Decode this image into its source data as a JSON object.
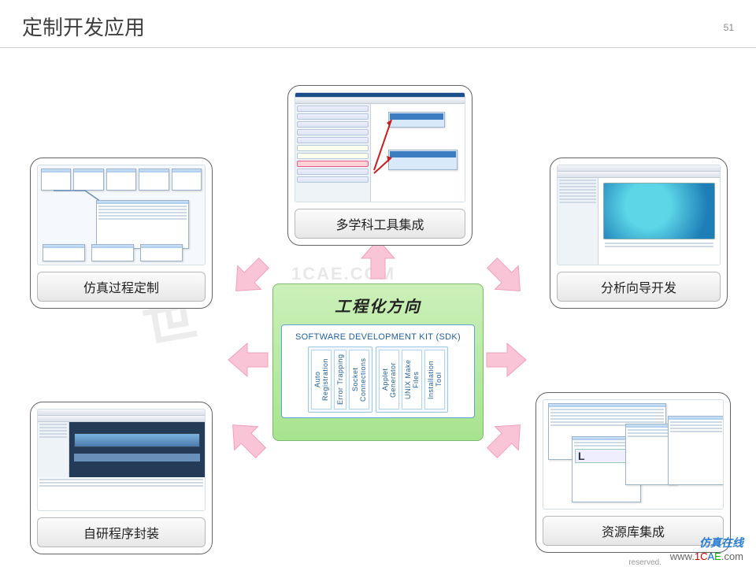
{
  "header": {
    "title": "定制开发应用",
    "page_number": "51"
  },
  "center": {
    "title": "工程化方向",
    "sdk_title": "SOFTWARE DEVELOPMENT KIT (SDK)",
    "group_a": [
      "Auto Registration",
      "Error Trapping",
      "Socket Connections"
    ],
    "group_b": [
      "Applet Generator",
      "UNIX Make Files",
      "Installation Tool"
    ]
  },
  "cards": {
    "top": {
      "label": "多学科工具集成"
    },
    "left": {
      "label": "仿真过程定制"
    },
    "right": {
      "label": "分析向导开发"
    },
    "bleft": {
      "label": "自研程序封装"
    },
    "bright": {
      "label": "资源库集成"
    }
  },
  "footer": {
    "reserved": "reserved.",
    "watermark_cn": "仿真在线",
    "watermark_url_parts": {
      "w": "www.",
      "c": "1C",
      "a": "A",
      "e": "E",
      "rest": ".com"
    }
  },
  "bg_watermark_main": "世",
  "bg_watermark_small": "1CAE.COM"
}
